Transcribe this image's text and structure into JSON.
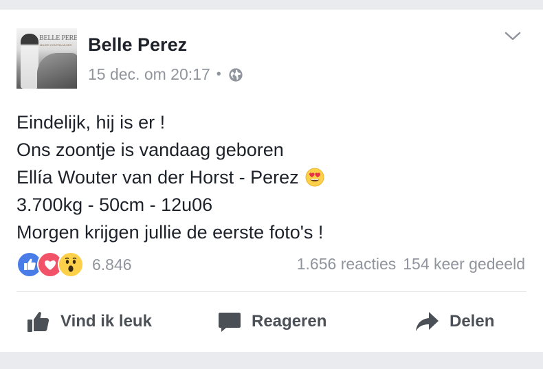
{
  "post": {
    "author": "Belle Perez",
    "avatar_logo": "BELLE PEREZ",
    "avatar_logo_sub": "MUJER CONTRA MUJER",
    "timestamp": "15 dec. om 20:17",
    "separator": "•",
    "privacy_icon": "globe-icon",
    "menu_icon": "chevron-down-icon",
    "lines": [
      "Eindelijk, hij is er !",
      "Ons zoontje is vandaag geboren",
      "Ellía Wouter van der Horst - Perez",
      "3.700kg - 50cm - 12u06",
      "Morgen krijgen jullie de eerste foto's !"
    ],
    "inline_emoji": "heart-eyes-emoji"
  },
  "stats": {
    "reaction_icons": [
      "like-reaction-icon",
      "love-reaction-icon",
      "wow-reaction-icon"
    ],
    "reaction_count": "6.846",
    "comments": "1.656 reacties",
    "shares": "154 keer gedeeld"
  },
  "actions": {
    "like": "Vind ik leuk",
    "comment": "Reageren",
    "share": "Delen"
  },
  "colors": {
    "like_blue": "#4a7ce8",
    "love_red": "#f25268",
    "wow_yellow": "#fcd048",
    "text": "#1d2129",
    "muted": "#90949c"
  }
}
